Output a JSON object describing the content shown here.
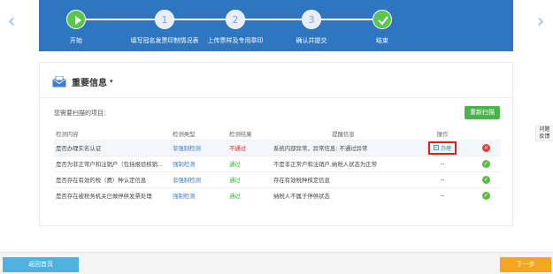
{
  "steps": [
    {
      "label": "开始",
      "icon": "play-icon"
    },
    {
      "label": "填写冠名发票印制情况表",
      "number": "1"
    },
    {
      "label": "上传票样及专用章印",
      "number": "2"
    },
    {
      "label": "确认并提交",
      "number": "3"
    },
    {
      "label": "结束",
      "icon": "check-icon"
    }
  ],
  "section": {
    "title": "重要信息",
    "caret": "▾"
  },
  "scan": {
    "hint": "您需要扫描的项目：",
    "rescan_label": "重新扫描"
  },
  "table": {
    "headers": [
      "检测内容",
      "检测类型",
      "检测结果",
      "提醒信息",
      "操作",
      ""
    ],
    "rows": [
      {
        "content": "是否办理实名认证",
        "type": "非强制检测",
        "result": "不通过",
        "result_status": "fail",
        "message": "系统内部异常，异常信息: 不通过异常",
        "op": "办理",
        "status_icon": "error-icon"
      },
      {
        "content": "是否为非正常户和注销户（包括报验核销...",
        "type": "强制检测",
        "result": "通过",
        "result_status": "pass",
        "message": "不是非正常户和注销户,纳税人状态为正常",
        "op": "--",
        "status_icon": "check-circle-icon"
      },
      {
        "content": "是否存在有效的税（费）种认定信息",
        "type": "非强制检测",
        "result": "通过",
        "result_status": "pass",
        "message": "存在有效税种核定信息",
        "op": "--",
        "status_icon": "check-circle-icon"
      },
      {
        "content": "是否存在被税务机关已做停供发票处理",
        "type": "强制检测",
        "result": "通过",
        "result_status": "pass",
        "message": "纳税人不属于停供状态",
        "op": "--",
        "status_icon": "check-circle-icon"
      }
    ]
  },
  "feedback": {
    "line1": "问题",
    "line2": "反馈"
  },
  "footer": {
    "back_label": "返回首页",
    "next_label": "下一步"
  }
}
